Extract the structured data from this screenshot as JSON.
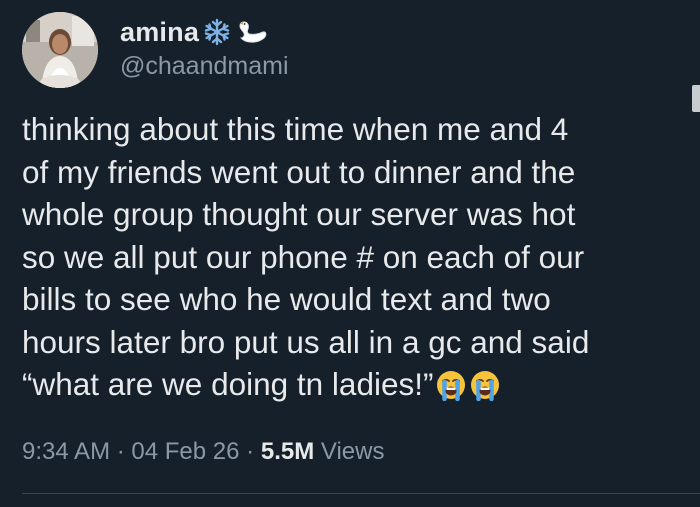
{
  "author": {
    "display_name": "amina",
    "name_emojis": [
      "snowflake-icon",
      "swan-icon"
    ],
    "handle": "@chaandmami",
    "avatar": "profile-photo"
  },
  "tweet": {
    "lines": [
      "thinking about this time when me and 4",
      "of my friends went out to dinner and the",
      "whole group thought our server was hot",
      "so we all put our phone # on each of our",
      "bills to see who he would text and two",
      "hours later bro put us all in a gc and said",
      "“what are we doing tn ladies!”"
    ],
    "trailing_emojis": [
      "loudly-crying-face-icon",
      "loudly-crying-face-icon"
    ]
  },
  "meta": {
    "time": "9:34 AM",
    "separator": "·",
    "date": "04 Feb 26",
    "views_count": "5.5M",
    "views_label": "Views"
  },
  "colors": {
    "background": "#15202b",
    "text": "#e7e9ea",
    "secondary_text": "#8b98a5",
    "divider": "#38444d",
    "emoji_snowflake": "#7fb2e5",
    "emoji_face": "#f7c33a",
    "emoji_tear": "#4fa3e8"
  }
}
